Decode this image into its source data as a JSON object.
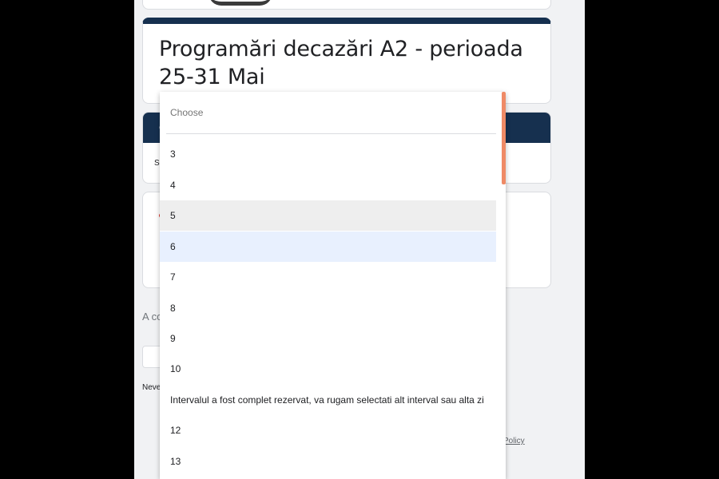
{
  "form": {
    "title": "Programări decazări A2 - perioada 25-31 Mai",
    "section_header_initial": "C",
    "section_body_initial": "S",
    "footer_note": "A co",
    "next_button": "N",
    "never_text": "Neve",
    "policy_link": "Policy"
  },
  "dropdown": {
    "placeholder": "Choose",
    "options": [
      "3",
      "4",
      "5",
      "6",
      "7",
      "8",
      "9",
      "10",
      "Intervalul a fost complet rezervat, va rugam selectati alt interval sau alta zi",
      "12",
      "13"
    ],
    "hovered": "5",
    "selected": "6"
  },
  "colors": {
    "header": "#16304f",
    "scrollbar": "#ef8a66",
    "selected_bg": "#e8f0fe",
    "hover_bg": "#eeeeee",
    "page_bg": "#f1f2f4"
  }
}
